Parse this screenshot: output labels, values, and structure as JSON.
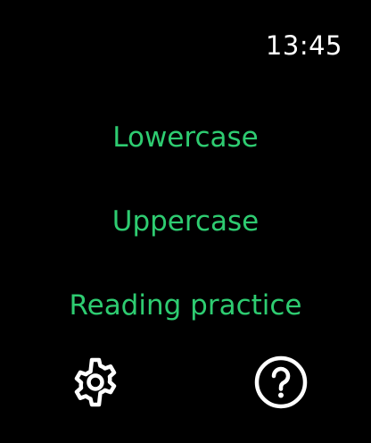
{
  "status_bar": {
    "time": "13:45"
  },
  "menu": {
    "items": [
      {
        "label": "Lowercase"
      },
      {
        "label": "Uppercase"
      },
      {
        "label": "Reading practice"
      }
    ]
  },
  "toolbar": {
    "settings_icon": "gear-icon",
    "help_icon": "question-circle-icon"
  },
  "colors": {
    "background": "#000000",
    "accent": "#2ecc71",
    "foreground": "#ffffff"
  }
}
